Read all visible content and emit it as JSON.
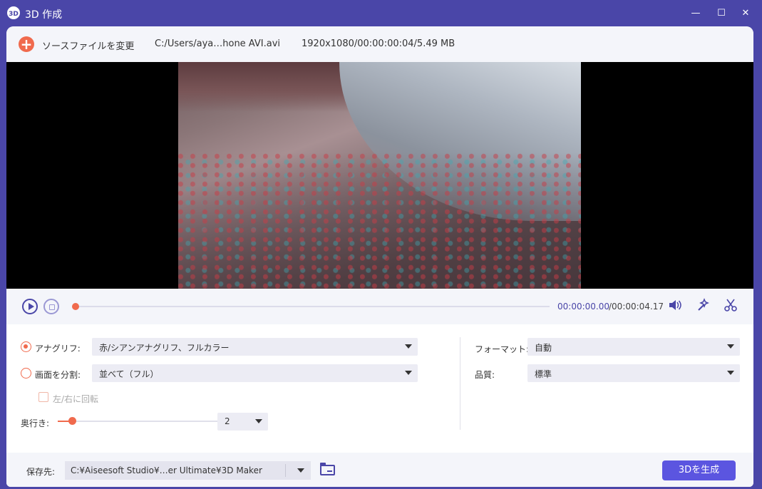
{
  "window": {
    "logo": "3D",
    "title": "3D 作成",
    "min_glyph": "—",
    "max_glyph": "☐",
    "close_glyph": "✕"
  },
  "topbar": {
    "add_glyph": "+",
    "change_source_label": "ソースファイルを変更",
    "file_path": "C:/Users/aya…hone AVI.avi",
    "file_info": "1920x1080/00:00:00:04/5.49 MB"
  },
  "player": {
    "time_current": "00:00:00.00",
    "time_total": "/00:00:04.17",
    "progress": 0,
    "icons": [
      "play-icon",
      "stop-icon",
      "volume-icon",
      "effect-icon",
      "cut-icon"
    ]
  },
  "settings": {
    "anaglyph_label": "アナグリフ:",
    "anaglyph_value": "赤/シアンアナグリフ、フルカラー",
    "split_label": "画面を分割:",
    "split_value": "並べて（フル）",
    "swap_label": "左/右に回転",
    "depth_label": "奥行き:",
    "depth_value": "2",
    "format_label": "フォーマット:",
    "format_value": "自動",
    "quality_label": "品質:",
    "quality_value": "標準"
  },
  "bottom": {
    "save_label": "保存先:",
    "save_path": "C:¥Aiseesoft Studio¥…er Ultimate¥3D Maker",
    "generate_label": "3Dを生成"
  },
  "colors": {
    "accent": "#4a46a8",
    "orange": "#f06a4d",
    "button": "#5b55e0"
  }
}
